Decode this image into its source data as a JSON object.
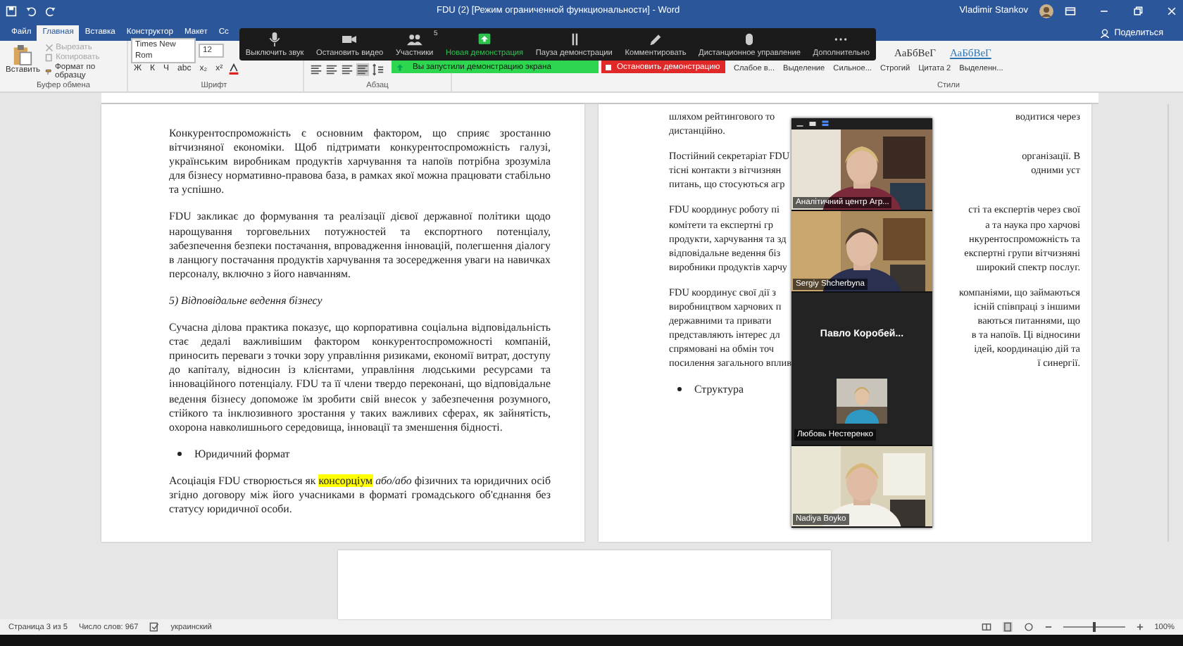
{
  "window": {
    "title": "FDU (2) [Режим ограниченной функциональности] - Word",
    "user": "Vladimir Stankov"
  },
  "ribbon_tabs": [
    {
      "label": "Файл",
      "selected": false
    },
    {
      "label": "Главная",
      "selected": true
    },
    {
      "label": "Вставка",
      "selected": false
    },
    {
      "label": "Конструктор",
      "selected": false
    },
    {
      "label": "Макет",
      "selected": false
    },
    {
      "label": "Сс",
      "selected": false
    }
  ],
  "share_button": "Поделиться",
  "clipboard": {
    "paste": "Вставить",
    "group": "Буфер обмена",
    "items": [
      {
        "label": "Вырезать",
        "disabled": true
      },
      {
        "label": "Копировать",
        "disabled": true
      },
      {
        "label": "Формат по образцу",
        "disabled": false
      }
    ]
  },
  "font": {
    "family": "Times New Rom",
    "size": "12",
    "group": "Шрифт",
    "buttons": [
      "Ж",
      "К",
      "Ч",
      "abc",
      "x₂",
      "x²"
    ]
  },
  "paragraph": {
    "group": "Абзац"
  },
  "styles": {
    "group": "Стили",
    "samples": [
      {
        "text": "АаБбВеГ",
        "kind": "plain"
      },
      {
        "text": "АаБбВеГ",
        "kind": "link"
      }
    ],
    "names": [
      "Слабое в...",
      "Выделение",
      "Сильное...",
      "Строгий",
      "Цитата 2",
      "Выделенн..."
    ]
  },
  "zoom_toolbar": {
    "items": [
      {
        "label": "Выключить звук",
        "kind": "mic"
      },
      {
        "label": "Остановить видео",
        "kind": "camera"
      },
      {
        "label": "Участники",
        "kind": "people",
        "count": "5"
      },
      {
        "label": "Новая демонстрация",
        "kind": "share"
      },
      {
        "label": "Пауза демонстрации",
        "kind": "pause"
      },
      {
        "label": "Комментировать",
        "kind": "pen"
      },
      {
        "label": "Дистанционное управление",
        "kind": "mouse"
      },
      {
        "label": "Дополнительно",
        "kind": "more"
      }
    ],
    "share_notice": "Вы запустили демонстрацию экрана",
    "stop_button": "Остановить демонстрацию"
  },
  "left_page": [
    {
      "kind": "paragraph",
      "text": "Конкурентоспроможність є основним фактором, що сприяє зростанню вітчизняної економіки. Щоб підтримати конкурентоспроможність галузі, українським виробникам продуктів харчування та напоїв потрібна зрозуміла для бізнесу нормативно-правова база, в рамках якої можна працювати стабільно та успішно."
    },
    {
      "kind": "paragraph",
      "text": "FDU закликає до формування та реалізації дієвої державної політики щодо нарощування торговельних потужностей та експортного потенціалу, забезпечення безпеки постачання, впровадження інновацій, полегшення діалогу в ланцюгу постачання продуктів харчування та зосередження уваги на навичках персоналу, включно з його навчанням."
    },
    {
      "kind": "heading",
      "text": "5) Відповідальне ведення бізнесу"
    },
    {
      "kind": "paragraph",
      "text": "Сучасна ділова практика показує, що корпоративна соціальна відповідальність стає дедалі важливішим фактором конкурентоспроможності компаній, приносить переваги з точки зору управління ризиками, економії витрат, доступу до капіталу, відносин із клієнтами, управління людськими ресурсами та інноваційного потенціалу. FDU та її члени твердо переконані, що відповідальне ведення бізнесу допоможе їм зробити свій внесок у забезпечення розумного, стійкого та інклюзивного зростання у таких важливих сферах, як зайнятість, охорона навколишнього середовища, інновації та зменшення бідності."
    },
    {
      "kind": "bullet",
      "text": "Юридичний формат"
    },
    {
      "kind": "paragraph",
      "text": "Асоціація FDU створюється як **консорціум** *або/або* фізичних та юридичних осіб згідно договору між його учасниками в форматі громадського об'єднання без статусу юридичної особи."
    }
  ],
  "right_page": {
    "paragraphs": [
      [
        {
          "left": "шляхом рейтингового то",
          "right": "водитися через"
        },
        {
          "left": "дистанційно."
        }
      ],
      [
        {
          "left": "Постійний секретаріат FDU",
          "right": "організації. В"
        },
        {
          "left": "тісні контакти з вітчизнян",
          "right": "одними уст"
        },
        {
          "left": "питань, що стосуються агр"
        }
      ],
      [
        {
          "left": "FDU координує роботу пі",
          "right": "сті та експертів через свої"
        },
        {
          "left": "комітети та експертні гр",
          "right": "а та наука про харчові"
        },
        {
          "left": "продукти, харчування та зд",
          "right": "нкурентоспроможність та"
        },
        {
          "left": "відповідальне ведення біз",
          "right": "експертні групи вітчизняні"
        },
        {
          "left": "виробники продуктів харчу",
          "right": "широкий спектр послуг."
        }
      ],
      [
        {
          "left": "FDU координує свої дії з",
          "right": "компаніями, що займаються"
        },
        {
          "left": "виробництвом харчових п",
          "right": "існій співпраці з іншими"
        },
        {
          "left": "державними та привати",
          "right": "ваються питаннями, що"
        },
        {
          "left": "представляють інтерес дл",
          "right": "в та напоїв. Ці відносини"
        },
        {
          "left": "спрямовані на обмін точ",
          "right": "ідей, координацію дій та"
        },
        {
          "left": "посилення загального вплив",
          "right": "ї синергії."
        }
      ]
    ],
    "bullet": "Структура"
  },
  "video_panel": {
    "tiles": [
      {
        "kind": "video",
        "name": "Аналітичний центр Агр..."
      },
      {
        "kind": "video",
        "name": "Sergiy Shcherbyna"
      },
      {
        "kind": "avatar",
        "title": "Павло Коробей...",
        "name": "Любовь Нестеренко"
      },
      {
        "kind": "video",
        "name": "Nadiya Boyko"
      }
    ]
  },
  "status_bar": {
    "page": "Страница 3 из 5",
    "words": "Число слов: 967",
    "language": "украинский",
    "zoom": {
      "level": 0.5,
      "reading": "100%"
    }
  }
}
